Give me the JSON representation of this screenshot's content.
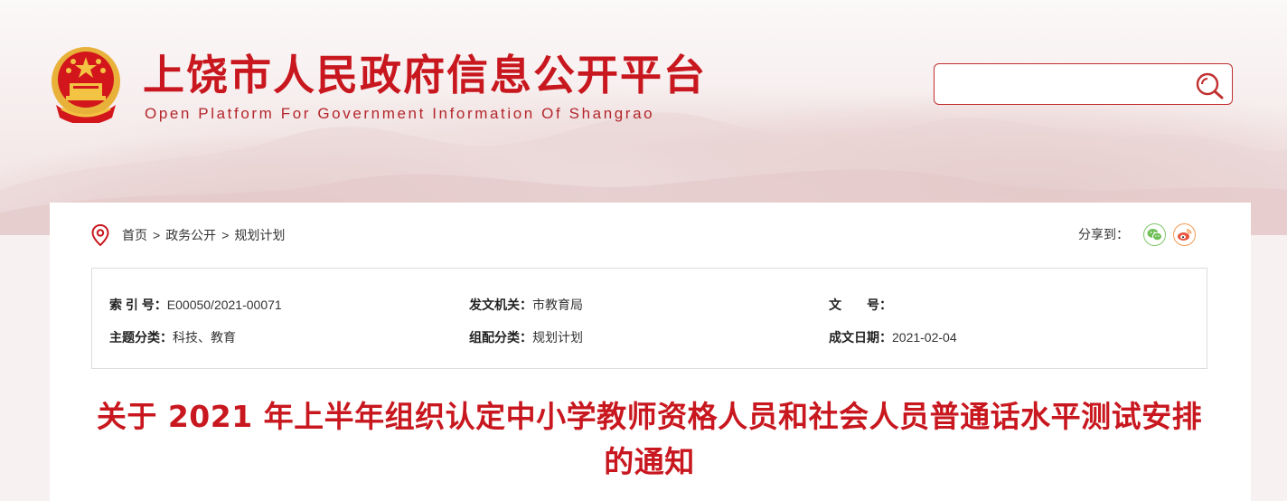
{
  "header": {
    "title": "上饶市人民政府信息公开平台",
    "subtitle": "Open Platform For Government Information Of Shangrao",
    "emblem_icon": "national-emblem-icon",
    "search": {
      "value": "",
      "placeholder": "",
      "icon": "search-icon"
    }
  },
  "breadcrumb": {
    "icon": "location-pin-icon",
    "items": [
      "首页",
      "政务公开",
      "规划计划"
    ],
    "separator": ">"
  },
  "share": {
    "label": "分享到：",
    "buttons": [
      {
        "name": "wechat",
        "icon": "wechat-icon",
        "color": "#7fc66a"
      },
      {
        "name": "weibo",
        "icon": "weibo-icon",
        "color": "#f29a52"
      }
    ]
  },
  "meta": {
    "index_label": "索 引 号：",
    "index_value": "E00050/2021-00071",
    "issuer_label": "发文机关：",
    "issuer_value": "市教育局",
    "docno_label": "文　　号：",
    "docno_value": "",
    "topic_label": "主题分类：",
    "topic_value": "科技、教育",
    "assoc_label": "组配分类：",
    "assoc_value": "规划计划",
    "date_label": "成文日期：",
    "date_value": "2021-02-04"
  },
  "document": {
    "title": "关于 2021 年上半年组织认定中小学教师资格人员和社会人员普通话水平测试安排的通知"
  },
  "colors": {
    "brand_red": "#c8171e",
    "border": "#dcdcdc"
  }
}
